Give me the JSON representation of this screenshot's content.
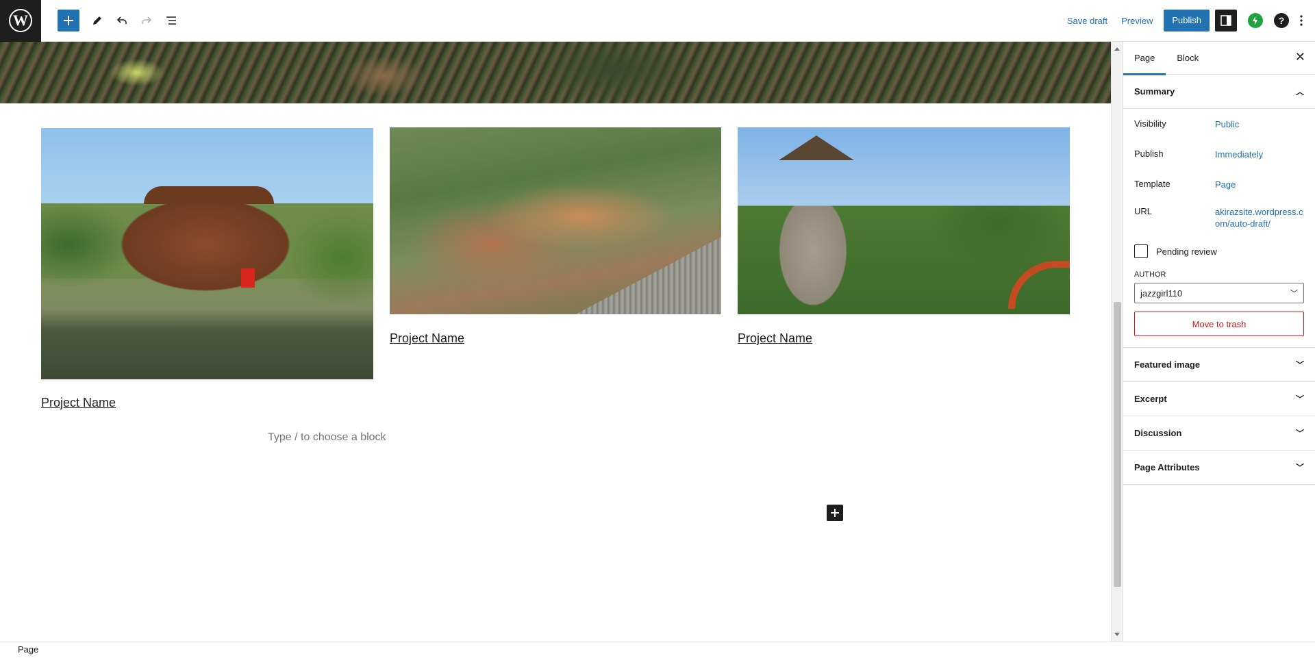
{
  "toolbar": {
    "save_draft": "Save draft",
    "preview": "Preview",
    "publish": "Publish"
  },
  "content": {
    "projects": [
      {
        "label": "Project Name"
      },
      {
        "label": "Project Name"
      },
      {
        "label": "Project Name"
      }
    ],
    "placeholder": "Type / to choose a block"
  },
  "sidebar": {
    "tabs": [
      "Page",
      "Block"
    ],
    "summary": {
      "title": "Summary",
      "visibility_label": "Visibility",
      "visibility_value": "Public",
      "publish_label": "Publish",
      "publish_value": "Immediately",
      "template_label": "Template",
      "template_value": "Page",
      "url_label": "URL",
      "url_value_line1": "akirazsite.wordpress.c",
      "url_value_line2": "om/auto-draft/",
      "pending_review": "Pending review",
      "author_label": "AUTHOR",
      "author_value": "jazzgirl110",
      "trash": "Move to trash"
    },
    "panels": [
      "Featured image",
      "Excerpt",
      "Discussion",
      "Page Attributes"
    ]
  },
  "footer": {
    "breadcrumb": "Page"
  },
  "colors": {
    "accent": "#2271b1",
    "danger": "#cc1818",
    "dark": "#1e1e1e"
  }
}
